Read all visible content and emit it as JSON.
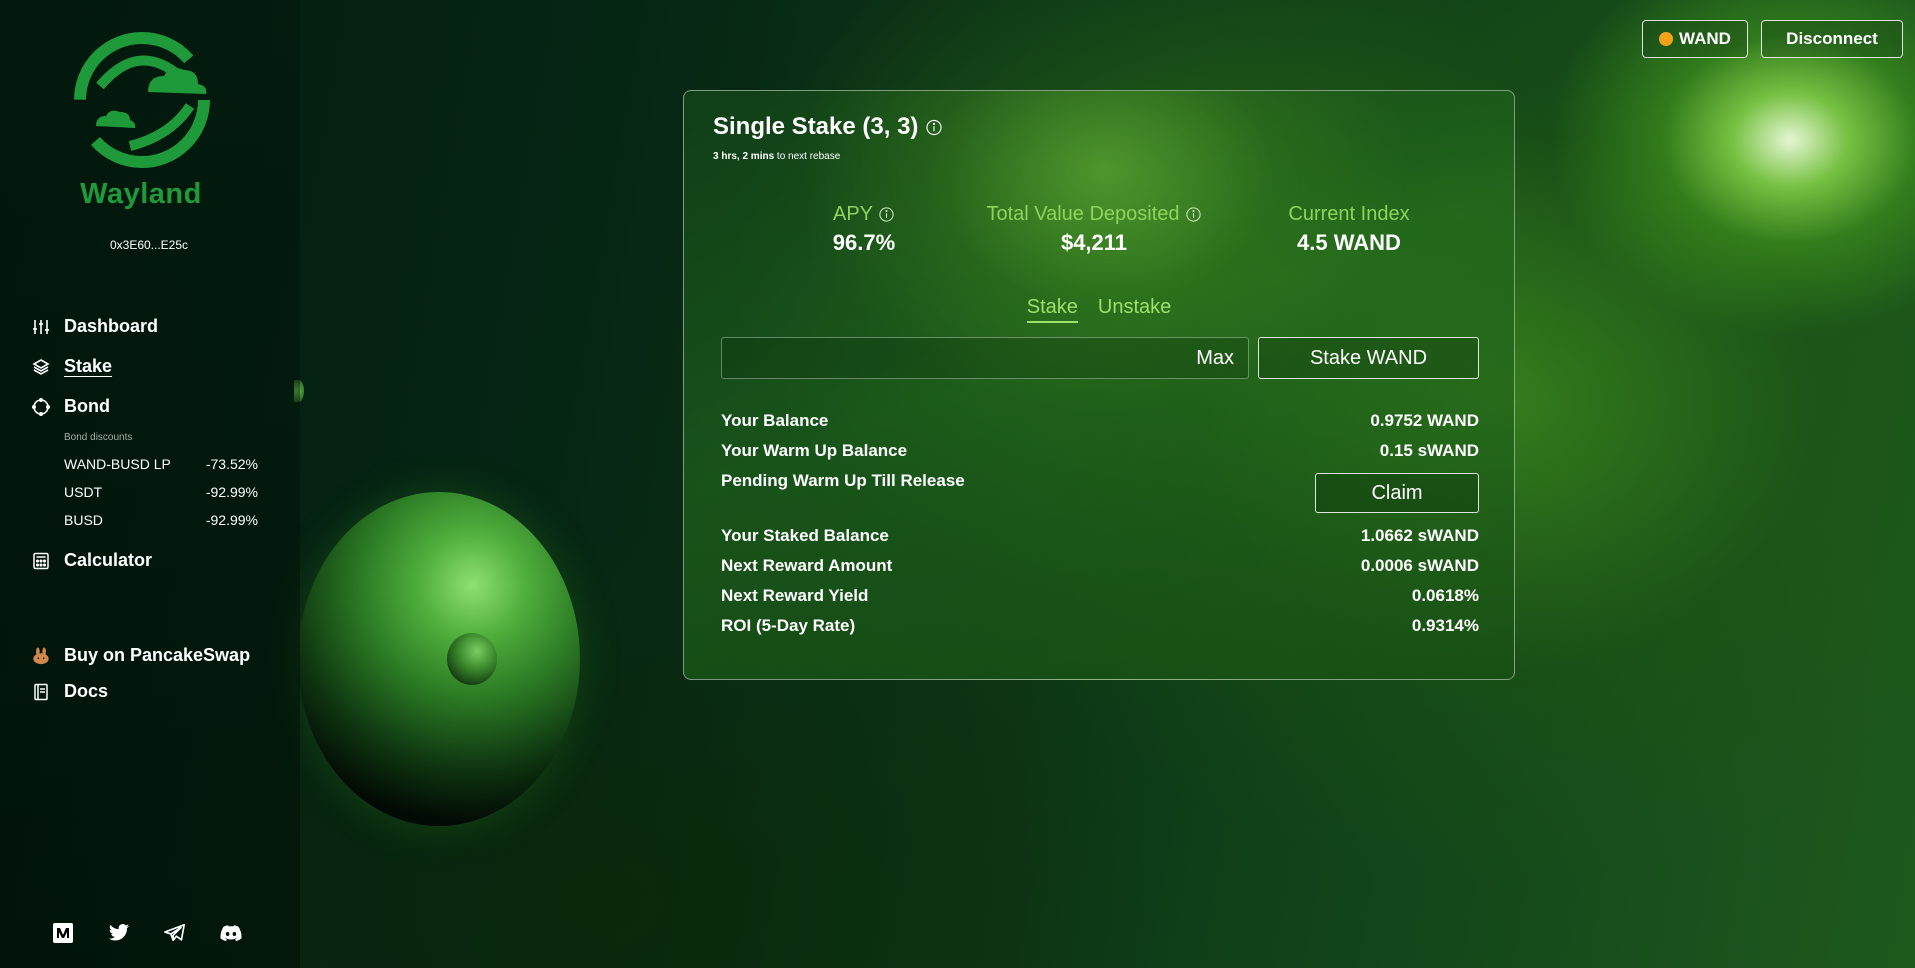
{
  "sidebar": {
    "brand": "Wayland",
    "address": "0x3E60...E25c",
    "nav": {
      "dashboard": "Dashboard",
      "stake": "Stake",
      "bond": "Bond",
      "calculator": "Calculator",
      "buy": "Buy on PancakeSwap",
      "docs": "Docs"
    },
    "bond_discounts_title": "Bond discounts",
    "bonds": [
      {
        "name": "WAND-BUSD LP",
        "discount": "-73.52%"
      },
      {
        "name": "USDT",
        "discount": "-92.99%"
      },
      {
        "name": "BUSD",
        "discount": "-92.99%"
      }
    ],
    "socials": [
      "medium-icon",
      "twitter-icon",
      "telegram-icon",
      "discord-icon"
    ]
  },
  "header": {
    "token_label": "WAND",
    "disconnect_label": "Disconnect"
  },
  "stake_card": {
    "title": "Single Stake (3, 3)",
    "rebase_time": "3 hrs, 2 mins",
    "rebase_suffix": "to next rebase",
    "metrics": {
      "apy_label": "APY",
      "apy_value": "96.7%",
      "tvd_label": "Total Value Deposited",
      "tvd_value": "$4,211",
      "index_label": "Current Index",
      "index_value": "4.5 WAND"
    },
    "tabs": [
      "Stake",
      "Unstake"
    ],
    "input": {
      "value": "",
      "placeholder": ""
    },
    "max_label": "Max",
    "stake_button": "Stake WAND",
    "claim_button": "Claim",
    "rows": [
      {
        "label": "Your Balance",
        "value": "0.9752 WAND"
      },
      {
        "label": "Your Warm Up Balance",
        "value": "0.15 sWAND"
      },
      {
        "label": "Pending Warm Up Till Release",
        "value": ""
      },
      {
        "label": "Your Staked Balance",
        "value": "1.0662 sWAND"
      },
      {
        "label": "Next Reward Amount",
        "value": "0.0006 sWAND"
      },
      {
        "label": "Next Reward Yield",
        "value": "0.0618%"
      },
      {
        "label": "ROI (5-Day Rate)",
        "value": "0.9314%"
      }
    ]
  },
  "colors": {
    "accent_green": "#8ed45c",
    "brand_green": "#1f9a3a",
    "token_dot": "#f3a21a"
  }
}
